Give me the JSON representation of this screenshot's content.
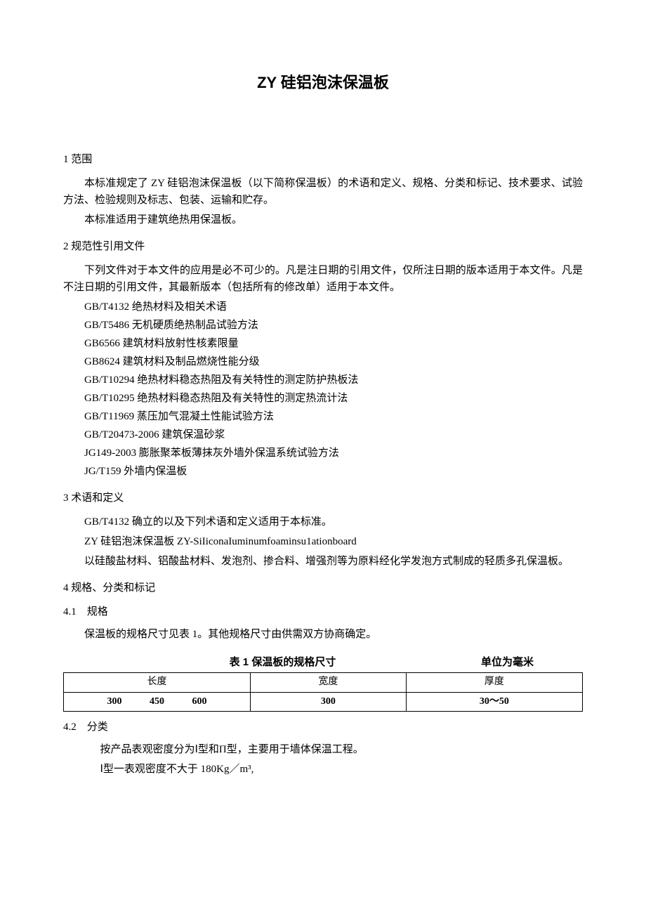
{
  "title": "ZY 硅铝泡沫保温板",
  "sections": {
    "s1": {
      "heading": "1 范围",
      "p1": "本标准规定了 ZY 硅铝泡沫保温板（以下简称保温板）的术语和定义、规格、分类和标记、技术要求、试验方法、检验规则及标志、包装、运输和贮存。",
      "p2": "本标准适用于建筑绝热用保温板。"
    },
    "s2": {
      "heading": "2 规范性引用文件",
      "p1": "下列文件对于本文件的应用是必不可少的。凡是注日期的引用文件，仅所注日期的版本适用于本文件。凡是不注日期的引用文件，其最新版本（包括所有的修改单）适用于本文件。",
      "refs": [
        "GB/T4132 绝热材料及相关术语",
        "GB/T5486 无机硬质绝热制品试验方法",
        "GB6566 建筑材料放射性核素限量",
        "GB8624 建筑材料及制品燃烧性能分级",
        "GB/T10294 绝热材料稳态热阻及有关特性的测定防护热板法",
        "GB/T10295 绝热材料稳态热阻及有关特性的测定热流计法",
        "GB/T11969 蒸压加气混凝土性能试验方法",
        "GB/T20473-2006 建筑保温砂浆",
        "JG149-2003 膨胀聚苯板薄抹灰外墙外保温系统试验方法",
        "JG/T159 外墙内保温板"
      ]
    },
    "s3": {
      "heading": "3 术语和定义",
      "p1": "GB/T4132 确立的以及下列术语和定义适用于本标准。",
      "p2": "ZY 硅铝泡沫保温板 ZY-SiIiconaIuminumfoaminsu1ationboard",
      "p3": "以硅酸盐材料、铝酸盐材料、发泡剂、掺合料、增强剂等为原料经化学发泡方式制成的轻质多孔保温板。"
    },
    "s4": {
      "heading": "4 规格、分类和标记",
      "s41": {
        "heading": "4.1　规格",
        "p1": "保温板的规格尺寸见表 1。其他规格尺寸由供需双方协商确定。"
      },
      "table": {
        "caption": "表 1 保温板的规格尺寸",
        "unit": "单位为毫米",
        "headers": [
          "长度",
          "宽度",
          "厚度"
        ],
        "row": {
          "length": [
            "300",
            "450",
            "600"
          ],
          "width": "300",
          "thickness": "30～50"
        }
      },
      "s42": {
        "heading": "4.2　分类",
        "p1": "按产品表观密度分为Ⅰ型和Π型，主要用于墙体保温工程。",
        "p2": "Ⅰ型一表观密度不大于 180Kg／m³,"
      }
    }
  }
}
